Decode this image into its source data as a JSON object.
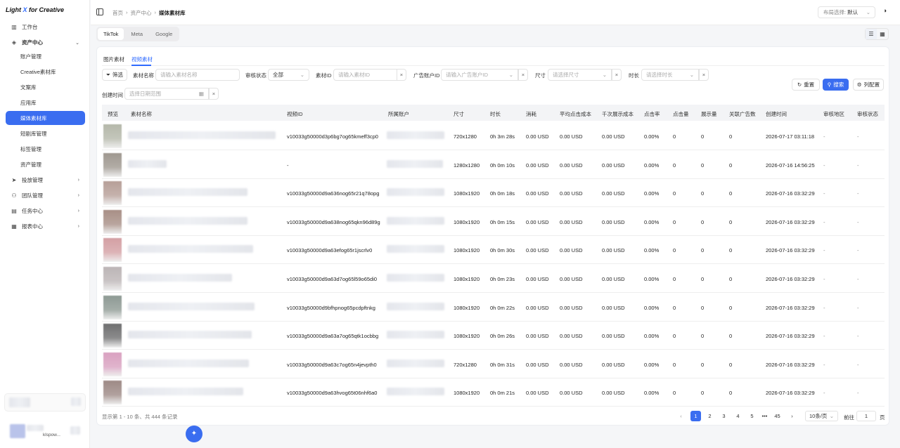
{
  "app": {
    "logo_prefix": "Light ",
    "logo_x": "X",
    "logo_suffix": " for Creative"
  },
  "sidebar": {
    "workbench": "工作台",
    "asset_center": "资产中心",
    "sub_items": [
      "账户管理",
      "Creative素材库",
      "文案库",
      "应用库",
      "媒体素材库",
      "短剧库管理",
      "标签管理",
      "资产管理"
    ],
    "delivery": "投放管理",
    "team": "团队管理",
    "tasks": "任务中心",
    "reports": "报表中心",
    "user_suffix": "klspow..."
  },
  "header": {
    "breadcrumb": [
      "首页",
      "资产中心",
      "媒体素材库"
    ],
    "layout_label": "布局选择:",
    "layout_value": "默认"
  },
  "platform_tabs": [
    "TikTok",
    "Meta",
    "Google"
  ],
  "material_tabs": [
    "图片素材",
    "视频素材"
  ],
  "filters": {
    "filter_btn": "筛选",
    "name_label": "素材名称",
    "name_placeholder": "请输入素材名称",
    "review_label": "审核状态",
    "review_value": "全部",
    "id_label": "素材ID",
    "id_placeholder": "请输入素材ID",
    "account_label": "广告账户ID",
    "account_placeholder": "请输入广告账户ID",
    "size_label": "尺寸",
    "size_placeholder": "请选择尺寸",
    "duration_label": "时长",
    "duration_placeholder": "请选择时长",
    "created_label": "创建时间",
    "created_placeholder": "选择日期范围",
    "reset": "重置",
    "search": "搜索",
    "columns": "列配置"
  },
  "table": {
    "columns": [
      "预览",
      "素材名称",
      "视频ID",
      "所属账户",
      "尺寸",
      "时长",
      "消耗",
      "平均点击成本",
      "千次展示成本",
      "点击率",
      "点击量",
      "展示量",
      "关联广告数",
      "创建时间",
      "审核地区",
      "审核状态"
    ],
    "rows": [
      {
        "video_id": "v10033g50000d3p6bg7og65kmeff3cp0",
        "size": "720x1280",
        "duration": "0h 3m 28s",
        "spend": "0.00 USD",
        "cpc": "0.00 USD",
        "cpm": "0.00 USD",
        "ctr": "0.00%",
        "clicks": "0",
        "impressions": "0",
        "ads": "0",
        "created": "2026-07-17 03:11:18",
        "region": "-",
        "status": "-",
        "thumb": "#b5b8aa"
      },
      {
        "video_id": "-",
        "size": "1280x1280",
        "duration": "0h 0m 10s",
        "spend": "0.00 USD",
        "cpc": "0.00 USD",
        "cpm": "0.00 USD",
        "ctr": "0.00%",
        "clicks": "0",
        "impressions": "0",
        "ads": "0",
        "created": "2026-07-16 14:56:25",
        "region": "-",
        "status": "-",
        "thumb": "#9f9890"
      },
      {
        "video_id": "v10033g50000d9a636nog65r21q78opg",
        "size": "1080x1920",
        "duration": "0h 0m 18s",
        "spend": "0.00 USD",
        "cpc": "0.00 USD",
        "cpm": "0.00 USD",
        "ctr": "0.00%",
        "clicks": "0",
        "impressions": "0",
        "ads": "0",
        "created": "2026-07-16 03:32:29",
        "region": "-",
        "status": "-",
        "thumb": "#b79f98"
      },
      {
        "video_id": "v10033g50000d9a638nog65qkn96d89g",
        "size": "1080x1920",
        "duration": "0h 0m 15s",
        "spend": "0.00 USD",
        "cpc": "0.00 USD",
        "cpm": "0.00 USD",
        "ctr": "0.00%",
        "clicks": "0",
        "impressions": "0",
        "ads": "0",
        "created": "2026-07-16 03:32:29",
        "region": "-",
        "status": "-",
        "thumb": "#a88f86"
      },
      {
        "video_id": "v10033g50000d9a63efog65r1jscrlv0",
        "size": "1080x1920",
        "duration": "0h 0m 30s",
        "spend": "0.00 USD",
        "cpc": "0.00 USD",
        "cpm": "0.00 USD",
        "ctr": "0.00%",
        "clicks": "0",
        "impressions": "0",
        "ads": "0",
        "created": "2026-07-16 03:32:29",
        "region": "-",
        "status": "-",
        "thumb": "#d4a0a4"
      },
      {
        "video_id": "v10033g50000d9a63d7og65l59o65di0",
        "size": "1080x1920",
        "duration": "0h 0m 23s",
        "spend": "0.00 USD",
        "cpc": "0.00 USD",
        "cpm": "0.00 USD",
        "ctr": "0.00%",
        "clicks": "0",
        "impressions": "0",
        "ads": "0",
        "created": "2026-07-16 03:32:29",
        "region": "-",
        "status": "-",
        "thumb": "#bcb5b6"
      },
      {
        "video_id": "v10033g50000d9bfhpnog65pcdpftnkg",
        "size": "1080x1920",
        "duration": "0h 0m 22s",
        "spend": "0.00 USD",
        "cpc": "0.00 USD",
        "cpm": "0.00 USD",
        "ctr": "0.00%",
        "clicks": "0",
        "impressions": "0",
        "ads": "0",
        "created": "2026-07-16 03:32:29",
        "region": "-",
        "status": "-",
        "thumb": "#8e9a94"
      },
      {
        "video_id": "v10033g50000d9a63a7og65qtk1ocbbg",
        "size": "1080x1920",
        "duration": "0h 0m 26s",
        "spend": "0.00 USD",
        "cpc": "0.00 USD",
        "cpm": "0.00 USD",
        "ctr": "0.00%",
        "clicks": "0",
        "impressions": "0",
        "ads": "0",
        "created": "2026-07-16 03:32:29",
        "region": "-",
        "status": "-",
        "thumb": "#6f6f70"
      },
      {
        "video_id": "v10033g50000d9a63c7og65n4jevpth0",
        "size": "720x1280",
        "duration": "0h 0m 31s",
        "spend": "0.00 USD",
        "cpc": "0.00 USD",
        "cpm": "0.00 USD",
        "ctr": "0.00%",
        "clicks": "0",
        "impressions": "0",
        "ads": "0",
        "created": "2026-07-16 03:32:29",
        "region": "-",
        "status": "-",
        "thumb": "#d9a1c0"
      },
      {
        "video_id": "v10033g50000d9a63hvog65t06nhf6a0",
        "size": "1080x1920",
        "duration": "0h 0m 21s",
        "spend": "0.00 USD",
        "cpc": "0.00 USD",
        "cpm": "0.00 USD",
        "ctr": "0.00%",
        "clicks": "0",
        "impressions": "0",
        "ads": "0",
        "created": "2026-07-16 03:32:29",
        "region": "-",
        "status": "-",
        "thumb": "#9e8a86"
      }
    ]
  },
  "footer": {
    "summary": "显示第 1 - 10 条、共 444 条记录",
    "pages": [
      "1",
      "2",
      "3",
      "4",
      "5"
    ],
    "ellipsis": "•••",
    "last_page": "45",
    "prev": "‹",
    "next": "›",
    "page_size": "10条/页",
    "goto_label": "前往",
    "goto_value": "1",
    "goto_suffix": "页"
  },
  "icons": {
    "fab": "sparkle-icon"
  }
}
